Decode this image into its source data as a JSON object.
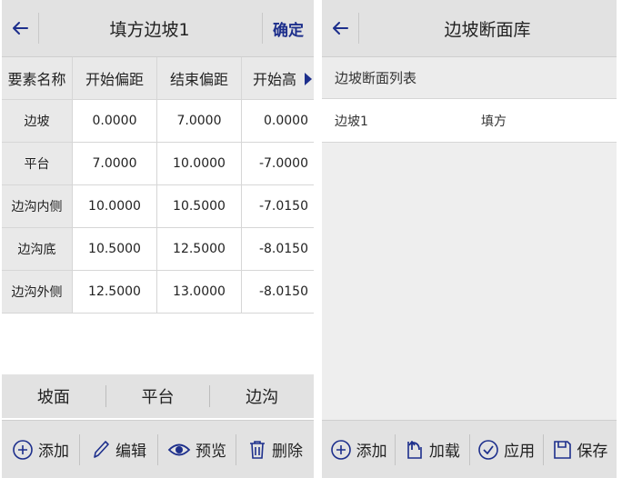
{
  "left_screen": {
    "title": "填方边坡1",
    "confirm_label": "确定",
    "columns": [
      "要素名称",
      "开始偏距",
      "结束偏距",
      "开始高"
    ],
    "rows": [
      [
        "边坡",
        "0.0000",
        "7.0000",
        "0.0000"
      ],
      [
        "平台",
        "7.0000",
        "10.0000",
        "-7.0000"
      ],
      [
        "边沟内侧",
        "10.0000",
        "10.5000",
        "-7.0150"
      ],
      [
        "边沟底",
        "10.5000",
        "12.5000",
        "-8.0150"
      ],
      [
        "边沟外侧",
        "12.5000",
        "13.0000",
        "-8.0150"
      ]
    ],
    "segment_tabs": [
      "坡面",
      "平台",
      "边沟"
    ],
    "toolbar": {
      "add_label": "添加",
      "edit_label": "编辑",
      "preview_label": "预览",
      "delete_label": "删除"
    }
  },
  "right_screen": {
    "title": "边坡断面库",
    "list_header": "边坡断面列表",
    "items": [
      {
        "name": "边坡1",
        "type": "填方"
      }
    ],
    "toolbar": {
      "add_label": "添加",
      "load_label": "加载",
      "apply_label": "应用",
      "save_label": "保存"
    }
  },
  "colors": {
    "accent": "#1d2f8c",
    "header_bg": "#e2e2e2",
    "empty_bg": "#eeeeee"
  },
  "icons": [
    "back-arrow-icon",
    "add-circle-icon",
    "pencil-icon",
    "eye-icon",
    "trash-icon",
    "load-icon",
    "check-circle-icon",
    "save-icon",
    "scroll-right-arrow-icon"
  ]
}
